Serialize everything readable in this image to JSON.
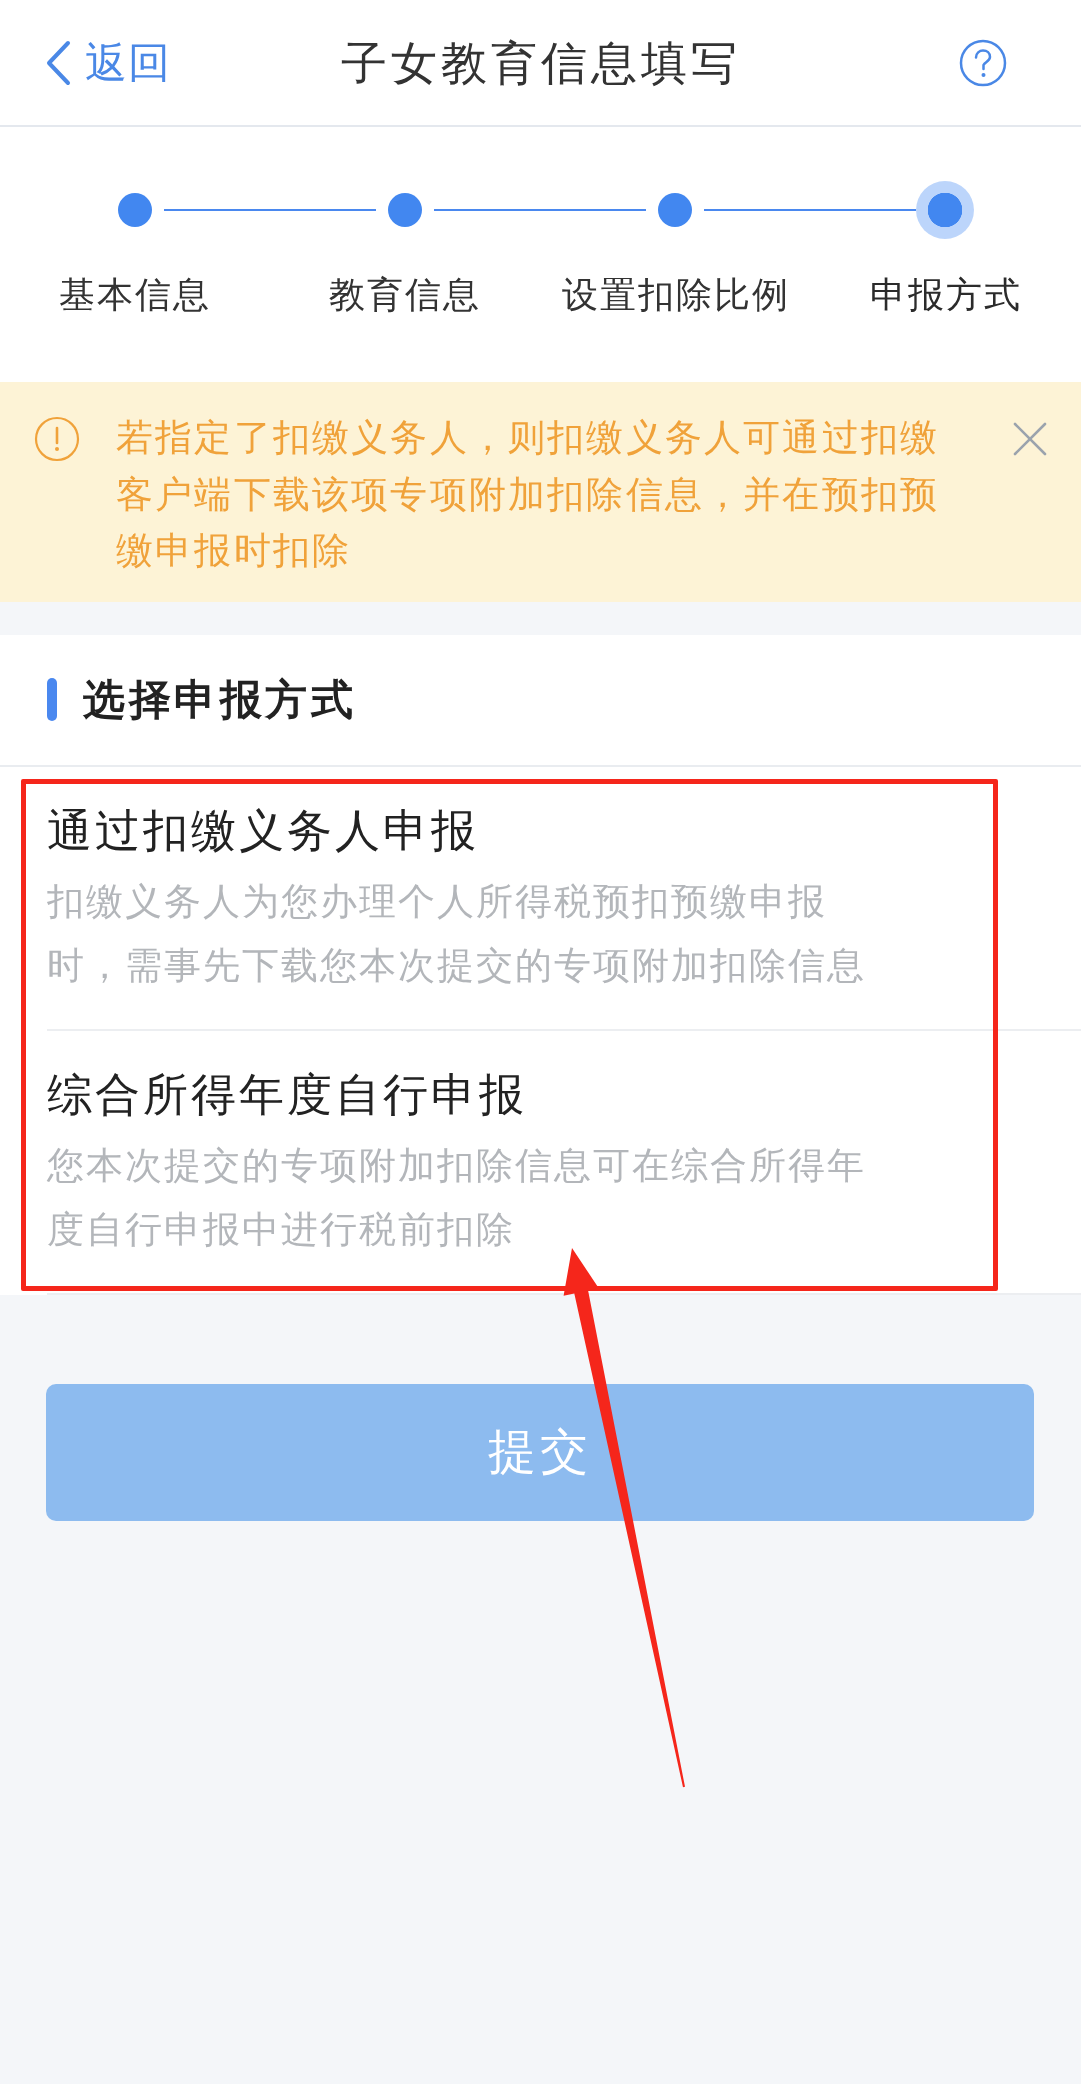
{
  "header": {
    "back": "返回",
    "title": "子女教育信息填写"
  },
  "steps": [
    {
      "label": "基本信息",
      "selected": false
    },
    {
      "label": "教育信息",
      "selected": false
    },
    {
      "label": "设置扣除比例",
      "selected": false
    },
    {
      "label": "申报方式",
      "selected": true
    }
  ],
  "notice": {
    "text": "若指定了扣缴义务人，则扣缴义务人可通过扣缴客户端下载该项专项附加扣除信息，并在预扣预缴申报时扣除"
  },
  "section": {
    "title": "选择申报方式",
    "options": [
      {
        "title": "通过扣缴义务人申报",
        "description": "扣缴义务人为您办理个人所得税预扣预缴申报时，需事先下载您本次提交的专项附加扣除信息"
      },
      {
        "title": "综合所得年度自行申报",
        "description": "您本次提交的专项附加扣除信息可在综合所得年度自行申报中进行税前扣除"
      }
    ]
  },
  "submit_button": {
    "label": "提交",
    "disabled": true
  }
}
